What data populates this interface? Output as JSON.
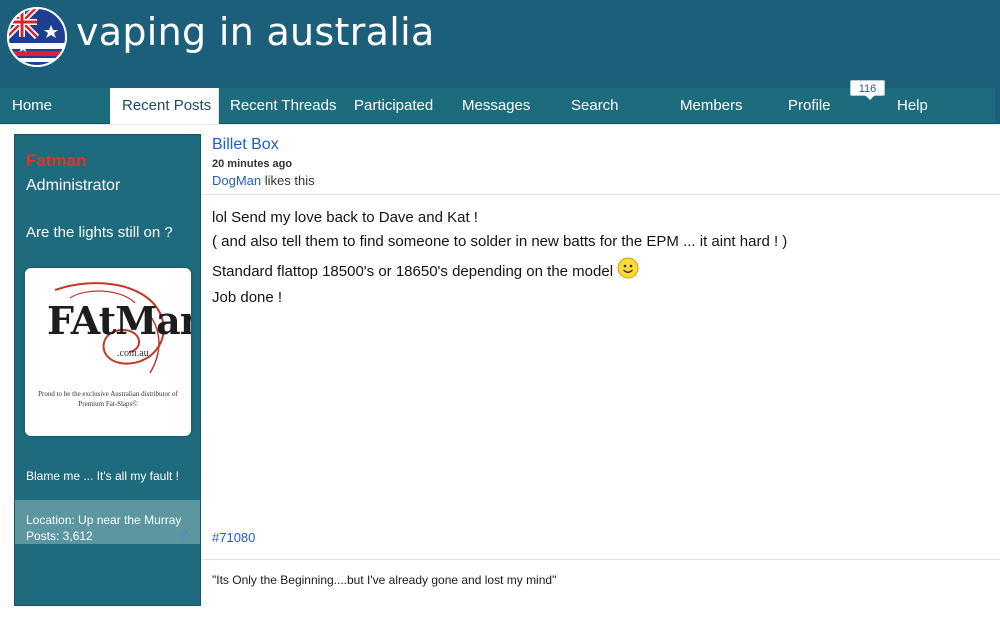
{
  "header": {
    "site_title": "vaping in australia",
    "logo_icon": "australian-flag-icon"
  },
  "nav": {
    "items": [
      {
        "label": "Home"
      },
      {
        "label": "Recent Posts"
      },
      {
        "label": "Recent Threads"
      },
      {
        "label": "Participated"
      },
      {
        "label": "Messages"
      },
      {
        "label": "Search"
      },
      {
        "label": "Members"
      },
      {
        "label": "Profile"
      },
      {
        "label": "Help"
      }
    ],
    "selected": "Recent Posts",
    "profile_badge": "116"
  },
  "user": {
    "name": "Fatman",
    "title": "Administrator",
    "tagline": "Are the lights still on ?",
    "avatar": {
      "brand": "FAtMan",
      "sub": ".com.au",
      "note": "Proud to be the exclusive Australian distributor of Premium Fat-Slaps©"
    },
    "blame": "Blame me ... It's all my fault !",
    "location": "Location: Up near the Murray",
    "posts": "Posts: 3,612",
    "gender_icon": "male-symbol-icon"
  },
  "post": {
    "title": "Billet Box",
    "time": "20 minutes ago",
    "liker": "DogMan",
    "likes_suffix": " likes this",
    "body": [
      "lol Send my love back to Dave and Kat !",
      "( and also tell them to find someone to solder in new batts for the EPM ... it aint hard ! )",
      "Standard flattop 18500's or 18650's depending on the model",
      "Job done !"
    ],
    "number": "#71080",
    "signature": "\"Its Only the Beginning....but I've already gone and lost my mind\""
  },
  "colors": {
    "header_bg": "#1b5f7a",
    "nav_bg": "#1c6c7d",
    "username": "#e4322b",
    "link": "#1f5fbf"
  }
}
